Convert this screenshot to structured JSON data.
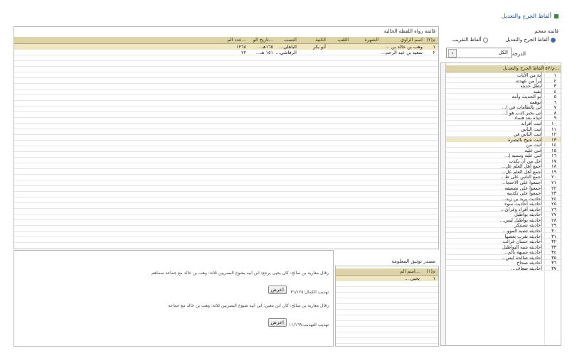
{
  "window_title": "ألفاظ الجرح والتعديل",
  "right_panel": {
    "title": "قائمة معجم",
    "radio_1": "ألفاظ الجرح والتعديل",
    "radio_2": "ألفاظ التقريب",
    "level_label": "الدرجة",
    "level_value": "الكل",
    "col_num": "م(١٥٧...",
    "col_word": "ألفاظ الجرح والتعديل",
    "items": [
      {
        "n": "١",
        "t": "آية من الآيات"
      },
      {
        "n": "٢",
        "t": "أبرأ من عهدته"
      },
      {
        "n": "٣",
        "t": "أبطل حديثه"
      },
      {
        "n": "٤",
        "t": "أبقيه"
      },
      {
        "n": "٥",
        "t": "أبو الحديث وأمه"
      },
      {
        "n": "٦",
        "t": "أتوهمه"
      },
      {
        "n": "٧",
        "t": "أتى بالطامات في ا..."
      },
      {
        "n": "٨",
        "t": "أتى بخبر كذب هو أ..."
      },
      {
        "n": "٩",
        "t": "أتيناه بعد فساد"
      },
      {
        "n": "١٠",
        "t": "أثبت أقرانه"
      },
      {
        "n": "١١",
        "t": "أثبت الناس"
      },
      {
        "n": "١٢",
        "t": "أثبت الناس في"
      },
      {
        "n": "١٣",
        "t": "أثبت شيخ بالبصرة"
      },
      {
        "n": "١٤",
        "t": "أثبت من"
      },
      {
        "n": "١٥",
        "t": "أثنى عليه"
      },
      {
        "n": "١٦",
        "t": "أثنى عليه ونسبه إ..."
      },
      {
        "n": "١٧",
        "t": "أجل من أن يكذب"
      },
      {
        "n": "١٨",
        "t": "أجمع أهل العلم عل..."
      },
      {
        "n": "١٩",
        "t": "أجمع أهل العلم عل..."
      },
      {
        "n": "٢٠",
        "t": "أجمع الناس على ط..."
      },
      {
        "n": "٢١",
        "t": "أجمعوا على الاحتجا..."
      },
      {
        "n": "٢٢",
        "t": "أجمعوا على تضعيفه"
      },
      {
        "n": "٢٣",
        "t": "أجمعوا على تكذيبه"
      },
      {
        "n": "٢٤",
        "t": "أحاديث يريد بن زيد..."
      },
      {
        "n": "٢٥",
        "t": "أحاديثه أحاديث سوء"
      },
      {
        "n": "٢٦",
        "t": "أحاديثه أفراد وغرائ..."
      },
      {
        "n": "٢٧",
        "t": "أحاديثه بواطيل"
      },
      {
        "n": "٢٨",
        "t": "أحاديثه بواطيل ليس..."
      },
      {
        "n": "٢٩",
        "t": "أحاديثه تستنكر"
      },
      {
        "n": "٣٠",
        "t": "أحاديثه تشبه الموو..."
      },
      {
        "n": "٣١",
        "t": "أحاديثه تقرب بعضها"
      },
      {
        "n": "٣٢",
        "t": "أحاديثه حسان غرائب"
      },
      {
        "n": "٣٣",
        "t": "أحاديثه شبه البواطيل"
      },
      {
        "n": "٣٤",
        "t": "أحاديثه شبيهة بالم..."
      },
      {
        "n": "٣٥",
        "t": "أحاديثه صالحة ليس..."
      },
      {
        "n": "٣٦",
        "t": "أحاديثه صحاح"
      },
      {
        "n": "٣٧",
        "t": "أحاديثه ضعاف..."
      }
    ]
  },
  "narrators": {
    "title": "قائمة رواة اللفظة الحالية",
    "headers": {
      "num": "م(٢)",
      "name": "اسم الراوي",
      "fame": "الشهرة",
      "title": "اللقب",
      "kunya": "الكنية",
      "nisba": "النسب",
      "death": "تاريخ الو...",
      "count": "عدد الم..."
    },
    "rows": [
      {
        "num": "١",
        "name": "وهب بن خالد بن ...",
        "fame": "",
        "title": "",
        "kunya": "أبو بكر",
        "nisba": "الباهلي...",
        "death": "١٦٥هـ...",
        "count": "١٢٦٨"
      },
      {
        "num": "٢",
        "name": "سعيد بن عبد الرحم...",
        "fame": "",
        "title": "",
        "kunya": "",
        "nisba": "الرقاشي...",
        "death": "١٥١ هـ...",
        "count": "٢٢"
      }
    ]
  },
  "source": {
    "title": "مصدر توثيق المعلومة",
    "col_num": "م(١)",
    "col_name": "اسم الم...",
    "rows": [
      {
        "num": "١",
        "name": "يحيى ..."
      }
    ],
    "entries": [
      {
        "text": "رقال معارية بن صالح: كان يحيى يرجع: ابن أبيه يشوخ البصريين ثلاثة: وهب بن خالد مع جماعة سماهم",
        "page_label": "تهذيب الكمال:٣١/١٢٥",
        "button": "اعرض"
      },
      {
        "text": "رقال معارية بن صالح: كان ابن معين: ابن أبيه شيوخ البصريين ثلاثة: وهب بن خالد مع جماعة",
        "page_label": "تهذيب التهذيب:١١/١٦٩",
        "button": "اعرض"
      }
    ]
  }
}
